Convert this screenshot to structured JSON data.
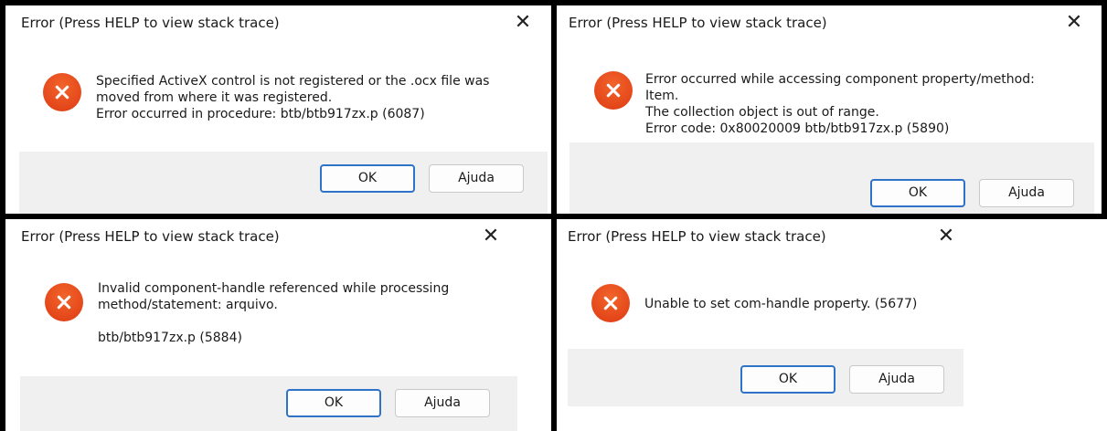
{
  "dialogs": [
    {
      "title": "Error (Press HELP to view stack trace)",
      "close_glyph": "✕",
      "message_lines": [
        "Specified ActiveX control is not registered or the .ocx file was",
        "moved from where it was registered.",
        "Error occurred in procedure: btb/btb917zx.p (6087)"
      ],
      "ok_label": "OK",
      "help_label": "Ajuda",
      "icon": "error-icon"
    },
    {
      "title": "Error (Press HELP to view stack trace)",
      "close_glyph": "✕",
      "message_lines": [
        "Error occurred while accessing component property/method:",
        "Item.",
        "The collection object is out of range.",
        "Error code: 0x80020009 btb/btb917zx.p (5890)"
      ],
      "ok_label": "OK",
      "help_label": "Ajuda",
      "icon": "error-icon"
    },
    {
      "title": "Error (Press HELP to view stack trace)",
      "close_glyph": "✕",
      "message_lines": [
        "Invalid component-handle referenced while processing",
        "method/statement: arquivo.",
        "",
        "btb/btb917zx.p (5884)"
      ],
      "ok_label": "OK",
      "help_label": "Ajuda",
      "icon": "error-icon"
    },
    {
      "title": "Error (Press HELP to view stack trace)",
      "close_glyph": "✕",
      "message_lines": [
        "Unable to set com-handle property. (5677)"
      ],
      "ok_label": "OK",
      "help_label": "Ajuda",
      "icon": "error-icon"
    }
  ],
  "colors": {
    "error_icon": "#e4471a",
    "primary_button_border": "#2f73c9",
    "footer_background": "#f0f0f0",
    "separator": "#000000"
  }
}
